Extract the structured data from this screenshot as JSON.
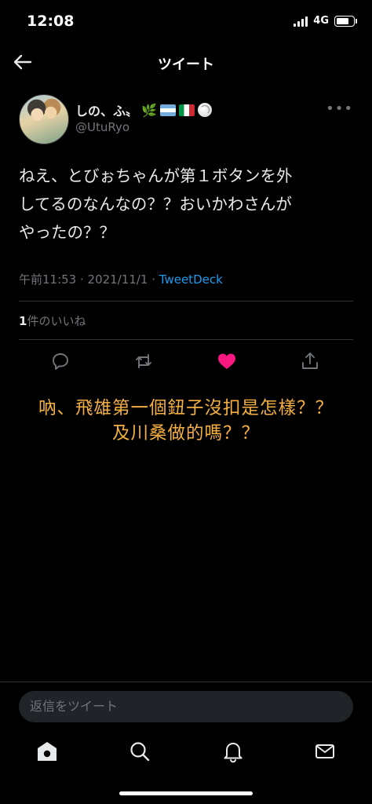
{
  "status_bar": {
    "time": "12:08",
    "network": "4G"
  },
  "header": {
    "title": "ツイート"
  },
  "tweet": {
    "user_name": "しの、ふ〟",
    "user_handle": "@UtuRyo",
    "text_lines": [
      "ねえ、とびぉちゃんが第１ボタンを外",
      "してるのなんなの？？おいかわさんが",
      "やったの？？"
    ],
    "time": "午前11:53",
    "date": "2021/11/1",
    "separator": " · ",
    "source": "TweetDeck",
    "likes_count": "1",
    "likes_label": "件のいいね"
  },
  "caption": {
    "lines": [
      "吶、飛雄第一個鈕子沒扣是怎樣？？",
      "及川桑做的嗎？？"
    ]
  },
  "reply": {
    "placeholder": "返信をツイート"
  },
  "colors": {
    "accent": "#1d9bf0",
    "like": "#f91880",
    "caption": "#f5b041",
    "muted": "#71767b"
  },
  "icons": {
    "actions": [
      "reply-icon",
      "retweet-icon",
      "like-icon-filled",
      "share-icon"
    ],
    "tabs": [
      "home-icon",
      "search-icon",
      "bell-icon",
      "mail-icon"
    ]
  }
}
